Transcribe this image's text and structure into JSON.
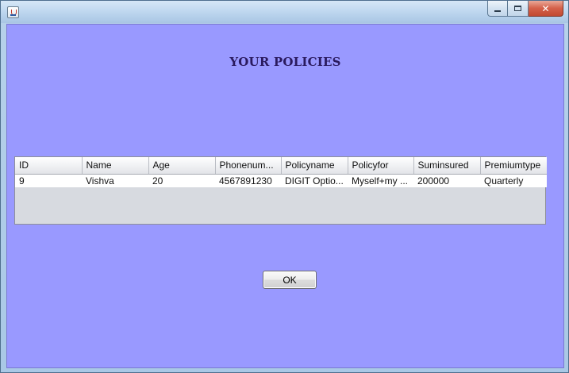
{
  "window": {
    "title": "",
    "controls": {
      "minimize": "minimize",
      "maximize": "maximize",
      "close": "✕"
    }
  },
  "heading": "YOUR POLICIES",
  "table": {
    "columns": [
      "ID",
      "Name",
      "Age",
      "Phonenum...",
      "Policyname",
      "Policyfor",
      "Suminsured",
      "Premiumtype"
    ],
    "rows": [
      [
        "9",
        "Vishva",
        "20",
        "4567891230",
        "DIGIT Optio...",
        "Myself+my ...",
        "200000",
        "Quarterly"
      ]
    ]
  },
  "ok_button": "OK"
}
